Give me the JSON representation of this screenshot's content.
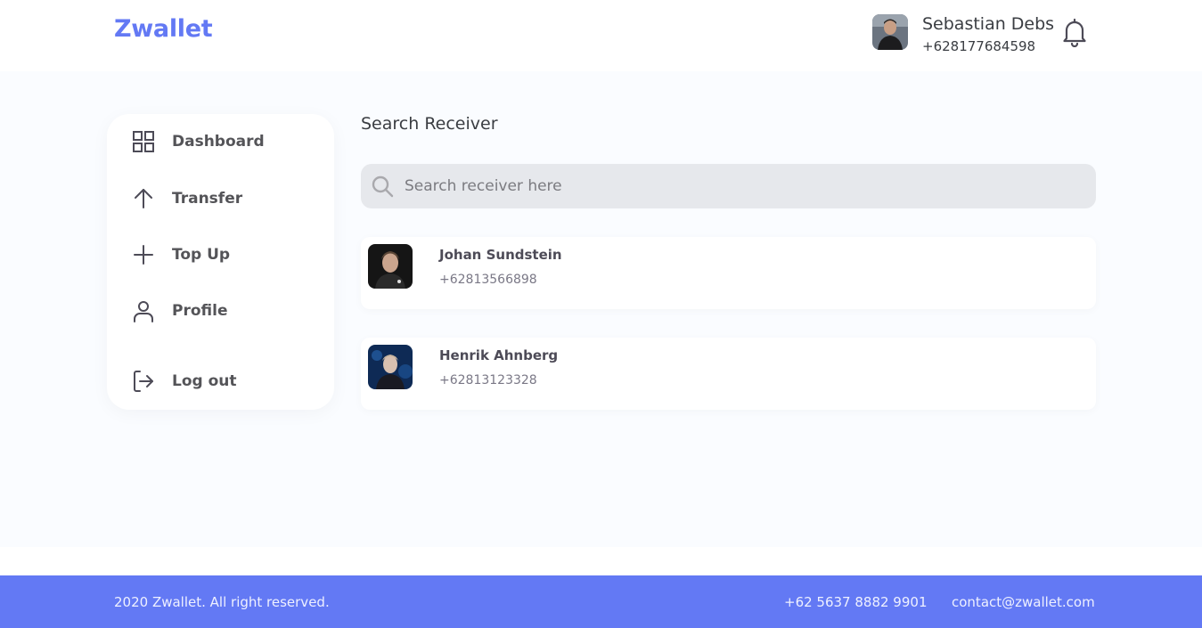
{
  "brand": "Zwallet",
  "header": {
    "user_name": "Sebastian Debs",
    "user_phone": "+628177684598",
    "avatar_icon": "user-photo",
    "bell_icon": "bell-icon"
  },
  "sidebar": {
    "items": [
      {
        "label": "Dashboard",
        "icon": "grid-icon"
      },
      {
        "label": "Transfer",
        "icon": "arrow-up-icon"
      },
      {
        "label": "Top Up",
        "icon": "plus-icon"
      },
      {
        "label": "Profile",
        "icon": "user-icon"
      },
      {
        "label": "Log out",
        "icon": "logout-icon"
      }
    ]
  },
  "content": {
    "title": "Search Receiver",
    "search": {
      "placeholder": "Search receiver here",
      "value": ""
    },
    "receivers": [
      {
        "name": "Johan Sundstein",
        "phone": "+62813566898"
      },
      {
        "name": "Henrik Ahnberg",
        "phone": "+62813123328"
      }
    ]
  },
  "footer": {
    "copyright": "2020 Zwallet. All right reserved.",
    "phone": "+62 5637 8882 9901",
    "email": "contact@zwallet.com"
  },
  "colors": {
    "accent": "#6379f4",
    "page_bg": "#fafcff",
    "search_bg": "#e6e8ec"
  }
}
